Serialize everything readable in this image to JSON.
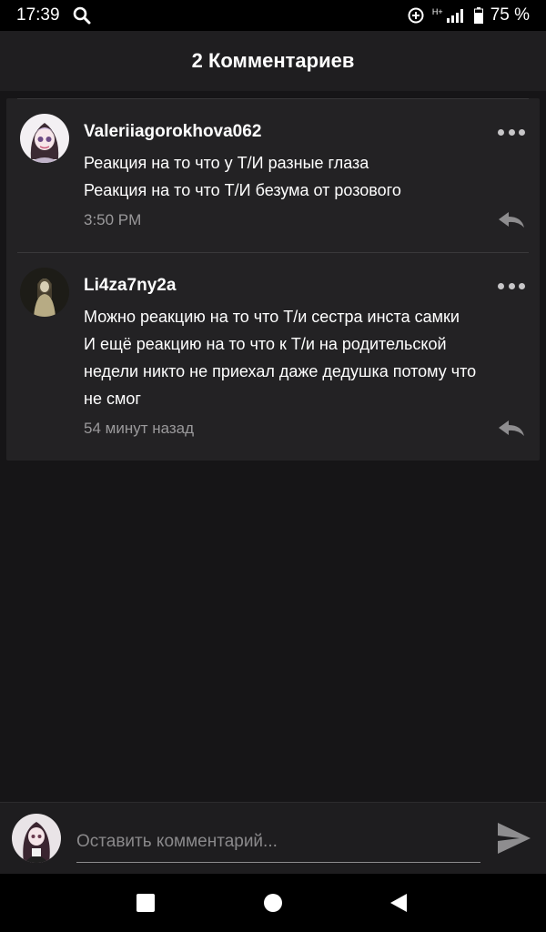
{
  "status_bar": {
    "time": "17:39",
    "network": "H+",
    "battery": "75 %"
  },
  "header": {
    "title": "2 Комментариев"
  },
  "comments": [
    {
      "username": "Valeriiagorokhova062",
      "lines": [
        "Реакция на то что у Т/И разные глаза",
        "Реакция на то что Т/И безума от розового"
      ],
      "time": "3:50 PM"
    },
    {
      "username": "Li4za7ny2a",
      "lines": [
        "Можно реакцию на то что Т/и сестра инста самки",
        "И ещё реакцию на то что к Т/и на родительской",
        "недели никто не приехал даже дедушка потому что",
        "не смог"
      ],
      "time": "54 минут назад"
    }
  ],
  "composer": {
    "placeholder": "Оставить комментарий..."
  },
  "colors": {
    "background": "#161517",
    "card": "#232224",
    "header": "#1f1e20",
    "secondary_text": "#9a999b"
  },
  "icons": [
    "search-icon",
    "sync-icon",
    "signal-icon",
    "battery-icon",
    "more-icon",
    "reply-icon",
    "send-icon",
    "recents-icon",
    "home-icon",
    "back-icon"
  ]
}
